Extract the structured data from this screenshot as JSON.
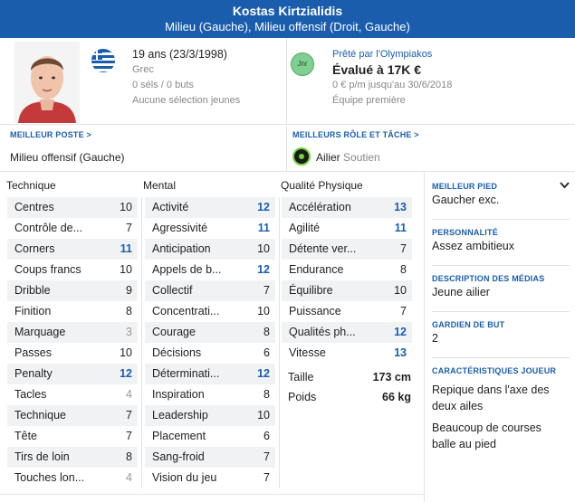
{
  "header": {
    "name": "Kostas Kirtzialidis",
    "positions": "Milieu (Gauche), Milieu offensif (Droit, Gauche)"
  },
  "profile": {
    "age": "19 ans (23/3/1998)",
    "nationality": "Grec",
    "caps": "0 séls / 0 buts",
    "youth_caps": "Aucune sélection jeunes"
  },
  "contract": {
    "loan_text": "Prêté par l'Olympiakos",
    "value": "Évalué à 17K €",
    "wage": "0 € p/m jusqu'au 30/6/2018",
    "squad": "Équipe première",
    "club_badge_text": "Jnr"
  },
  "best_position": {
    "label": "MEILLEUR POSTE >",
    "value": "Milieu offensif (Gauche)"
  },
  "best_role": {
    "label": "MEILLEURS RÔLE ET TÂCHE >",
    "role": "Ailier",
    "duty": "Soutien"
  },
  "columns": {
    "technical": "Technique",
    "mental": "Mental",
    "physical": "Qualité Physique"
  },
  "technical": [
    {
      "name": "Centres",
      "value": "10",
      "style": "normal"
    },
    {
      "name": "Contrôle de...",
      "value": "7",
      "style": "normal"
    },
    {
      "name": "Corners",
      "value": "11",
      "style": "blue"
    },
    {
      "name": "Coups francs",
      "value": "10",
      "style": "normal"
    },
    {
      "name": "Dribble",
      "value": "9",
      "style": "normal"
    },
    {
      "name": "Finition",
      "value": "8",
      "style": "normal"
    },
    {
      "name": "Marquage",
      "value": "3",
      "style": "grey"
    },
    {
      "name": "Passes",
      "value": "10",
      "style": "normal"
    },
    {
      "name": "Penalty",
      "value": "12",
      "style": "blue"
    },
    {
      "name": "Tacles",
      "value": "4",
      "style": "grey"
    },
    {
      "name": "Technique",
      "value": "7",
      "style": "normal"
    },
    {
      "name": "Tête",
      "value": "7",
      "style": "normal"
    },
    {
      "name": "Tirs de loin",
      "value": "8",
      "style": "normal"
    },
    {
      "name": "Touches lon...",
      "value": "4",
      "style": "grey"
    }
  ],
  "mental": [
    {
      "name": "Activité",
      "value": "12",
      "style": "blue"
    },
    {
      "name": "Agressivité",
      "value": "11",
      "style": "blue"
    },
    {
      "name": "Anticipation",
      "value": "10",
      "style": "normal"
    },
    {
      "name": "Appels de b...",
      "value": "12",
      "style": "blue"
    },
    {
      "name": "Collectif",
      "value": "7",
      "style": "normal"
    },
    {
      "name": "Concentrati...",
      "value": "10",
      "style": "normal"
    },
    {
      "name": "Courage",
      "value": "8",
      "style": "normal"
    },
    {
      "name": "Décisions",
      "value": "6",
      "style": "normal"
    },
    {
      "name": "Déterminati...",
      "value": "12",
      "style": "blue"
    },
    {
      "name": "Inspiration",
      "value": "8",
      "style": "normal"
    },
    {
      "name": "Leadership",
      "value": "10",
      "style": "normal"
    },
    {
      "name": "Placement",
      "value": "6",
      "style": "normal"
    },
    {
      "name": "Sang-froid",
      "value": "7",
      "style": "normal"
    },
    {
      "name": "Vision du jeu",
      "value": "7",
      "style": "normal"
    }
  ],
  "physical": [
    {
      "name": "Accélération",
      "value": "13",
      "style": "blue"
    },
    {
      "name": "Agilité",
      "value": "11",
      "style": "blue"
    },
    {
      "name": "Détente ver...",
      "value": "7",
      "style": "normal"
    },
    {
      "name": "Endurance",
      "value": "8",
      "style": "normal"
    },
    {
      "name": "Équilibre",
      "value": "10",
      "style": "normal"
    },
    {
      "name": "Puissance",
      "value": "7",
      "style": "normal"
    },
    {
      "name": "Qualités ph...",
      "value": "12",
      "style": "blue"
    },
    {
      "name": "Vitesse",
      "value": "13",
      "style": "blue"
    }
  ],
  "physical_extra": {
    "height_label": "Taille",
    "height_value": "173 cm",
    "weight_label": "Poids",
    "weight_value": "66 kg"
  },
  "side": {
    "foot_label": "MEILLEUR PIED",
    "foot_value": "Gaucher exc.",
    "personality_label": "PERSONNALITÉ",
    "personality_value": "Assez ambitieux",
    "media_label": "DESCRIPTION DES MÉDIAS",
    "media_value": "Jeune ailier",
    "gk_label": "GARDIEN DE BUT",
    "gk_value": "2",
    "traits_label": "CARACTÉRISTIQUES JOUEUR",
    "trait1": "Repique dans l'axe des deux ailes",
    "trait2": "Beaucoup de courses balle au pied"
  },
  "colors": {
    "accent": "#1a5dad",
    "highlight_value": "#1a5dad",
    "low_value": "#999999",
    "row_alt": "#f1f2f4"
  }
}
